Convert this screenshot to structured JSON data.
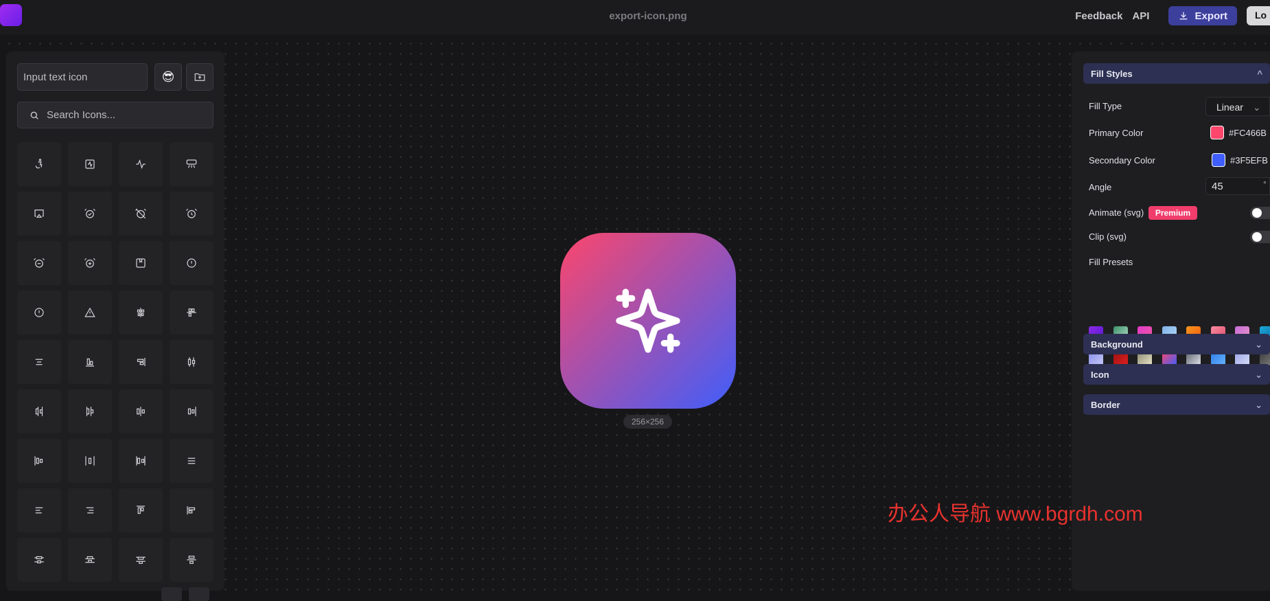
{
  "header": {
    "filename": "export-icon.png",
    "nav": {
      "feedback": "Feedback",
      "api": "API",
      "export": "Export",
      "login": "Lo"
    }
  },
  "left_panel": {
    "text_input_placeholder": "Input text icon",
    "emoji_button": "😎",
    "search_placeholder": "Search Icons..."
  },
  "preview": {
    "size_label": "256×256"
  },
  "right_panel": {
    "fill_styles": {
      "title": "Fill Styles",
      "fill_type_label": "Fill Type",
      "fill_type_value": "Linear",
      "primary_label": "Primary Color",
      "primary_value": "#FC466B",
      "secondary_label": "Secondary Color",
      "secondary_value": "#3F5EFB",
      "angle_label": "Angle",
      "angle_value": "45",
      "angle_unit": "°",
      "animate_label": "Animate (svg)",
      "premium_badge": "Premium",
      "clip_label": "Clip (svg)",
      "presets_label": "Fill Presets",
      "presets": [
        [
          "#8a2be2",
          "#5a16d8"
        ],
        [
          "#3a8f6a",
          "#b6e2c8"
        ],
        [
          "#e03ac8",
          "#f05aa0"
        ],
        [
          "#7fb1e8",
          "#b6d9f5"
        ],
        [
          "#f7971e",
          "#f05a10"
        ],
        [
          "#f78ca0",
          "#e04a6a"
        ],
        [
          "#c66cd8",
          "#e894c4"
        ],
        [
          "#1aa8d8",
          "#0d6fa8"
        ],
        [
          "#8a8ee8",
          "#c4c8f8"
        ],
        [
          "#9b1010",
          "#e02020"
        ],
        [
          "#8a8870",
          "#e8e4c8"
        ],
        [
          "#fc466b",
          "#3f5efb"
        ],
        [
          "#5a5f6a",
          "#e0e2e8"
        ],
        [
          "#2c7be5",
          "#66b2ff"
        ],
        [
          "#9ba4e8",
          "#d6dcf8"
        ],
        [
          "#3a3a3a",
          "#808080"
        ]
      ]
    },
    "background_title": "Background",
    "icon_title": "Icon",
    "border_title": "Border"
  },
  "watermark": "办公人导航 www.bgrdh.com",
  "colors": {
    "accent": "#3D3F9C",
    "primary": "#FC466B",
    "secondary": "#3F5EFB",
    "premium": "#F03D6C"
  }
}
